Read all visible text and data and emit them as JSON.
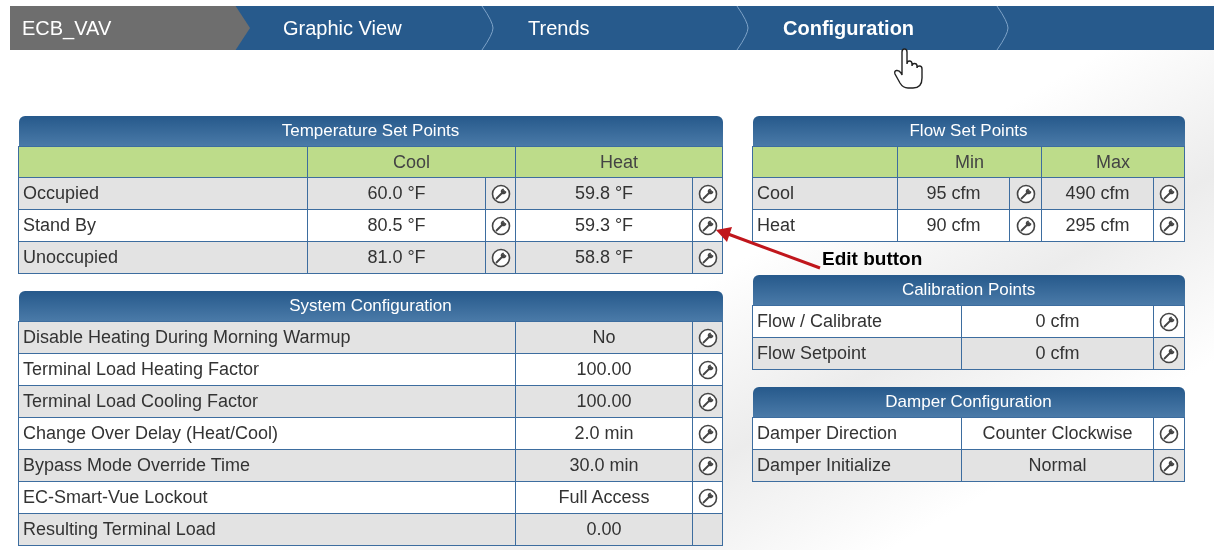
{
  "nav": {
    "tabs": [
      {
        "label": "ECB_VAV",
        "kind": "device",
        "selected": false
      },
      {
        "label": "Graphic View",
        "kind": "page",
        "selected": false
      },
      {
        "label": "Trends",
        "kind": "page",
        "selected": false
      },
      {
        "label": "Configuration",
        "kind": "page",
        "selected": true
      }
    ]
  },
  "left_panels": [
    {
      "title": "Temperature Set Points",
      "kind": "pair",
      "columns": [
        "Cool",
        "Heat"
      ],
      "rows": [
        {
          "label": "Occupied",
          "shaded": true,
          "cells": [
            {
              "value": "60.0 °F",
              "editable": true
            },
            {
              "value": "59.8 °F",
              "editable": true
            }
          ]
        },
        {
          "label": "Stand By",
          "shaded": false,
          "cells": [
            {
              "value": "80.5 °F",
              "editable": true
            },
            {
              "value": "59.3 °F",
              "editable": true
            }
          ]
        },
        {
          "label": "Unoccupied",
          "shaded": true,
          "cells": [
            {
              "value": "81.0 °F",
              "editable": true
            },
            {
              "value": "58.8 °F",
              "editable": true
            }
          ]
        }
      ]
    },
    {
      "title": "System Configuration",
      "kind": "single",
      "rows": [
        {
          "label": "Disable Heating During Morning Warmup",
          "shaded": true,
          "cells": [
            {
              "value": "No",
              "editable": true
            }
          ]
        },
        {
          "label": "Terminal Load Heating Factor",
          "shaded": false,
          "cells": [
            {
              "value": "100.00",
              "editable": true
            }
          ]
        },
        {
          "label": "Terminal Load Cooling Factor",
          "shaded": true,
          "cells": [
            {
              "value": "100.00",
              "editable": true
            }
          ]
        },
        {
          "label": "Change Over Delay (Heat/Cool)",
          "shaded": false,
          "cells": [
            {
              "value": "2.0 min",
              "editable": true
            }
          ]
        },
        {
          "label": "Bypass Mode Override Time",
          "shaded": true,
          "cells": [
            {
              "value": "30.0 min",
              "editable": true
            }
          ]
        },
        {
          "label": "EC-Smart-Vue Lockout",
          "shaded": false,
          "cells": [
            {
              "value": "Full Access",
              "editable": true
            }
          ]
        },
        {
          "label": "Resulting Terminal Load",
          "shaded": true,
          "cells": [
            {
              "value": "0.00",
              "editable": false
            }
          ]
        }
      ]
    }
  ],
  "right_panels": [
    {
      "title": "Flow Set Points",
      "kind": "pair",
      "columns": [
        "Min",
        "Max"
      ],
      "rows": [
        {
          "label": "Cool",
          "shaded": true,
          "cells": [
            {
              "value": "95 cfm",
              "editable": true
            },
            {
              "value": "490 cfm",
              "editable": true
            }
          ]
        },
        {
          "label": "Heat",
          "shaded": false,
          "cells": [
            {
              "value": "90 cfm",
              "editable": true
            },
            {
              "value": "295 cfm",
              "editable": true
            }
          ]
        }
      ]
    },
    {
      "title": "Calibration Points",
      "kind": "single",
      "rows": [
        {
          "label": "Flow / Calibrate",
          "shaded": false,
          "cells": [
            {
              "value": "0 cfm",
              "editable": true
            }
          ]
        },
        {
          "label": "Flow Setpoint",
          "shaded": true,
          "cells": [
            {
              "value": "0 cfm",
              "editable": true
            }
          ]
        }
      ]
    },
    {
      "title": "Damper Configuration",
      "kind": "single",
      "rows": [
        {
          "label": "Damper Direction",
          "shaded": false,
          "cells": [
            {
              "value": "Counter Clockwise",
              "editable": true
            }
          ]
        },
        {
          "label": "Damper Initialize",
          "shaded": true,
          "cells": [
            {
              "value": "Normal",
              "editable": true
            }
          ]
        }
      ]
    }
  ],
  "annotation": {
    "label": "Edit button"
  }
}
